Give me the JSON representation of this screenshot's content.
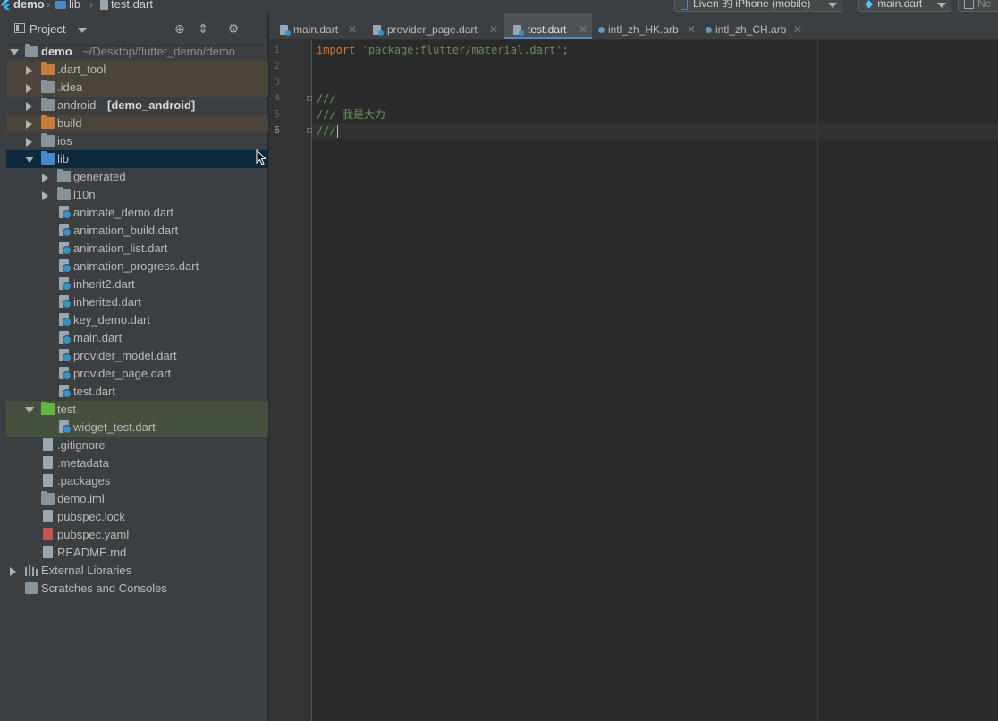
{
  "breadcrumb": [
    "demo",
    "lib",
    "test.dart"
  ],
  "toolbar": {
    "device": "Liven 的 iPhone (mobile)",
    "run_config": "main.dart",
    "next_label": "Ne"
  },
  "project_panel": {
    "title": "Project",
    "tree": [
      {
        "label": "demo",
        "path": "~/Desktop/flutter_demo/demo",
        "kind": "module-folder",
        "arrow": "down",
        "bold": true
      },
      {
        "label": ".dart_tool",
        "kind": "folder-orange",
        "arrow": "right",
        "hl": "orange"
      },
      {
        "label": ".idea",
        "kind": "folder-gear",
        "arrow": "right",
        "hl": "orange"
      },
      {
        "label": "android",
        "suffix": "[demo_android]",
        "kind": "folder-module",
        "arrow": "right"
      },
      {
        "label": "build",
        "kind": "folder-orange",
        "arrow": "right",
        "hl": "orange"
      },
      {
        "label": "ios",
        "kind": "folder",
        "arrow": "right"
      },
      {
        "label": "lib",
        "kind": "folder-blue",
        "arrow": "down",
        "selected": true
      },
      {
        "label": "generated",
        "kind": "folder",
        "arrow": "right"
      },
      {
        "label": "l10n",
        "kind": "folder",
        "arrow": "right"
      },
      {
        "label": "animate_demo.dart",
        "kind": "dart"
      },
      {
        "label": "animation_build.dart",
        "kind": "dart"
      },
      {
        "label": "animation_list.dart",
        "kind": "dart"
      },
      {
        "label": "animation_progress.dart",
        "kind": "dart"
      },
      {
        "label": "inherit2.dart",
        "kind": "dart"
      },
      {
        "label": "inherited.dart",
        "kind": "dart"
      },
      {
        "label": "key_demo.dart",
        "kind": "dart"
      },
      {
        "label": "main.dart",
        "kind": "dart"
      },
      {
        "label": "provider_model.dart",
        "kind": "dart"
      },
      {
        "label": "provider_page.dart",
        "kind": "dart"
      },
      {
        "label": "test.dart",
        "kind": "dart"
      },
      {
        "label": "test",
        "kind": "folder-green",
        "arrow": "down",
        "hl": "green"
      },
      {
        "label": "widget_test.dart",
        "kind": "dart",
        "hl": "green"
      },
      {
        "label": ".gitignore",
        "kind": "file"
      },
      {
        "label": ".metadata",
        "kind": "file"
      },
      {
        "label": ".packages",
        "kind": "file"
      },
      {
        "label": "demo.iml",
        "kind": "iml"
      },
      {
        "label": "pubspec.lock",
        "kind": "file"
      },
      {
        "label": "pubspec.yaml",
        "kind": "yaml"
      },
      {
        "label": "README.md",
        "kind": "file"
      },
      {
        "label": "External Libraries",
        "kind": "libraries",
        "arrow": "right"
      },
      {
        "label": "Scratches and Consoles",
        "kind": "scratches"
      }
    ]
  },
  "tabs": [
    {
      "label": "main.dart",
      "icon": "dart-file-icon"
    },
    {
      "label": "provider_page.dart",
      "icon": "dart-file-icon"
    },
    {
      "label": "test.dart",
      "icon": "dart-file-icon",
      "active": true
    },
    {
      "label": "intl_zh_HK.arb",
      "icon": "arb-file-icon"
    },
    {
      "label": "intl_zh_CH.arb",
      "icon": "arb-file-icon"
    }
  ],
  "editor": {
    "line_numbers": [
      "1",
      "2",
      "3",
      "4",
      "5",
      "6"
    ],
    "current_line": "6",
    "lines": [
      {
        "kw": "import",
        "str": "'package:flutter/material.dart'",
        "semi": ";"
      },
      {},
      {},
      {
        "comment": "///"
      },
      {
        "comment": "/// 我是大力"
      },
      {
        "comment": "///"
      }
    ]
  },
  "colors": {
    "panel_bg": "#3c3f41",
    "editor_bg": "#2b2b2b",
    "selection": "#0d293e",
    "keyword": "#cc7832",
    "string": "#6a8759",
    "doc_comment": "#629755"
  }
}
